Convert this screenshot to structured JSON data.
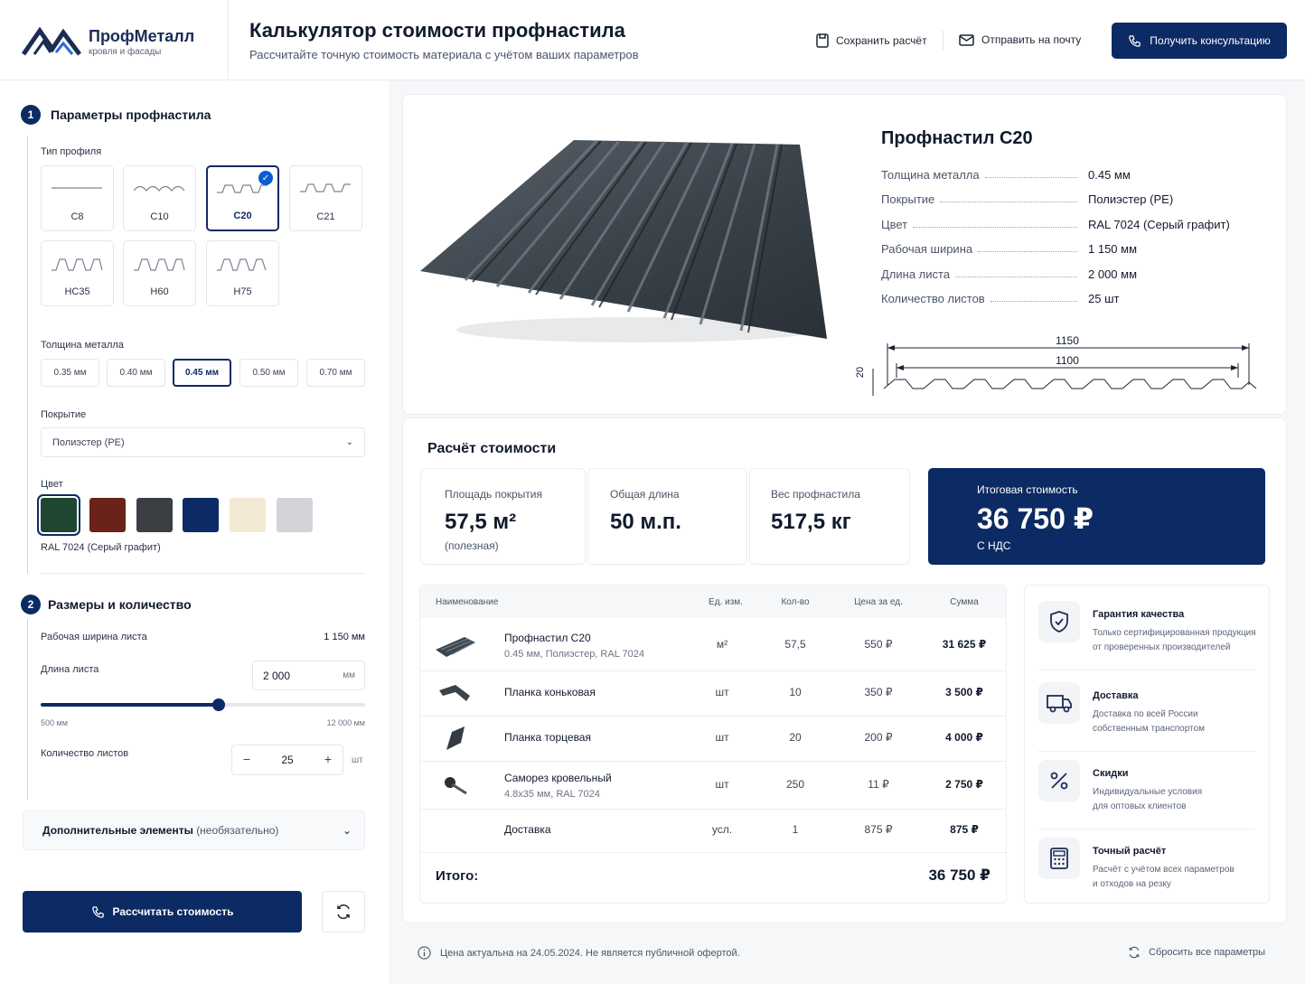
{
  "brand": {
    "name": "ПрофМеталл",
    "tagline": "кровля и фасады"
  },
  "header": {
    "title": "Калькулятор стоимости профнастила",
    "subtitle": "Рассчитайте точную стоимость материала с учётом ваших параметров",
    "save_label": "Сохранить расчёт",
    "email_label": "Отправить на почту",
    "consult_label": "Получить консультацию"
  },
  "params": {
    "step1": "1",
    "title1": "Параметры профнастила",
    "profile_type_label": "Тип профиля",
    "profiles": [
      {
        "name": "C8"
      },
      {
        "name": "C10"
      },
      {
        "name": "C20"
      },
      {
        "name": "C21"
      },
      {
        "name": "HC35"
      },
      {
        "name": "H60"
      },
      {
        "name": "H75"
      }
    ],
    "selected_profile": "C20",
    "thickness_label": "Толщина металла",
    "thicknesses": [
      "0.35 мм",
      "0.40 мм",
      "0.45 мм",
      "0.50 мм",
      "0.70 мм"
    ],
    "selected_thickness": "0.45 мм",
    "coating_label": "Покрытие",
    "coating_value": "Полиэстер (PE)",
    "color_label": "Цвет",
    "colors": [
      "#1e4630",
      "#6b2218",
      "#3b3f44",
      "#0b2a66",
      "#f3ead4",
      "#d2d4d8"
    ],
    "color_name": "RAL 7024 (Серый графит)",
    "step2": "2",
    "title2": "Размеры и количество",
    "width_label": "Рабочая ширина листа",
    "width_value": "1 150 мм",
    "length_label": "Длина листа",
    "length_value": "2 000",
    "length_unit": "мм",
    "slider_min": "500 мм",
    "slider_max": "12 000 мм",
    "slider_fraction": 0.55,
    "qty_label": "Количество листов",
    "qty_value": "25",
    "qty_unit": "шт",
    "qty_minus": "−",
    "qty_plus": "+",
    "extra_label": "Дополнительные элементы",
    "extra_optional": "(необязательно)",
    "calc_label": "Рассчитать стоимость"
  },
  "product": {
    "title": "Профнастил С20",
    "specs": [
      {
        "k": "Толщина металла",
        "v": "0.45 мм"
      },
      {
        "k": "Покрытие",
        "v": "Полиэстер (PE)"
      },
      {
        "k": "Цвет",
        "v": "RAL 7024 (Серый графит)"
      },
      {
        "k": "Рабочая ширина",
        "v": "1 150 мм"
      },
      {
        "k": "Длина листа",
        "v": "2 000 мм"
      },
      {
        "k": "Количество листов",
        "v": "25 шт"
      }
    ],
    "dim_total": "1150",
    "dim_work": "1100",
    "dim_height": "20"
  },
  "calc": {
    "title": "Расчёт стоимости",
    "area_label": "Площадь покрытия",
    "area_value": "57,5 м²",
    "area_note": "(полезная)",
    "length_label": "Общая длина",
    "length_value": "50 м.п.",
    "weight_label": "Вес профнастила",
    "weight_value": "517,5 кг",
    "total_label": "Итоговая стоимость",
    "total_value": "36 750 ₽",
    "total_note": "С НДС"
  },
  "table": {
    "headers": [
      "Наименование",
      "Ед. изм.",
      "Кол-во",
      "Цена за ед.",
      "Сумма"
    ],
    "rows": [
      {
        "name": "Профнастил С20",
        "sub": "0.45 мм, Полиэстер, RAL 7024",
        "unit": "м²",
        "qty": "57,5",
        "price": "550 ₽",
        "sum": "31 625 ₽"
      },
      {
        "name": "Планка коньковая",
        "sub": "",
        "unit": "шт",
        "qty": "10",
        "price": "350 ₽",
        "sum": "3 500 ₽"
      },
      {
        "name": "Планка торцевая",
        "sub": "",
        "unit": "шт",
        "qty": "20",
        "price": "200 ₽",
        "sum": "4 000 ₽"
      },
      {
        "name": "Саморез кровельный",
        "sub": "4.8x35 мм, RAL 7024",
        "unit": "шт",
        "qty": "250",
        "price": "11 ₽",
        "sum": "2 750 ₽"
      },
      {
        "name": "Доставка",
        "sub": "",
        "unit": "усл.",
        "qty": "1",
        "price": "875 ₽",
        "sum": "875 ₽"
      }
    ],
    "total_label": "Итого:",
    "total_value": "36 750 ₽"
  },
  "features": [
    {
      "icon": "shield-check-icon",
      "title": "Гарантия качества",
      "desc1": "Только сертифицированная продукция",
      "desc2": "от проверенных производителей"
    },
    {
      "icon": "truck-icon",
      "title": "Доставка",
      "desc1": "Доставка по всей России",
      "desc2": "собственным транспортом"
    },
    {
      "icon": "percent-icon",
      "title": "Скидки",
      "desc1": "Индивидуальные условия",
      "desc2": "для оптовых клиентов"
    },
    {
      "icon": "calculator-icon",
      "title": "Точный расчёт",
      "desc1": "Расчёт с учётом всех параметров",
      "desc2": "и отходов на резку"
    }
  ],
  "footer": {
    "note": "Цена актуальна на 24.05.2024. Не является публичной офертой.",
    "reset_label": "Сбросить все параметры"
  }
}
